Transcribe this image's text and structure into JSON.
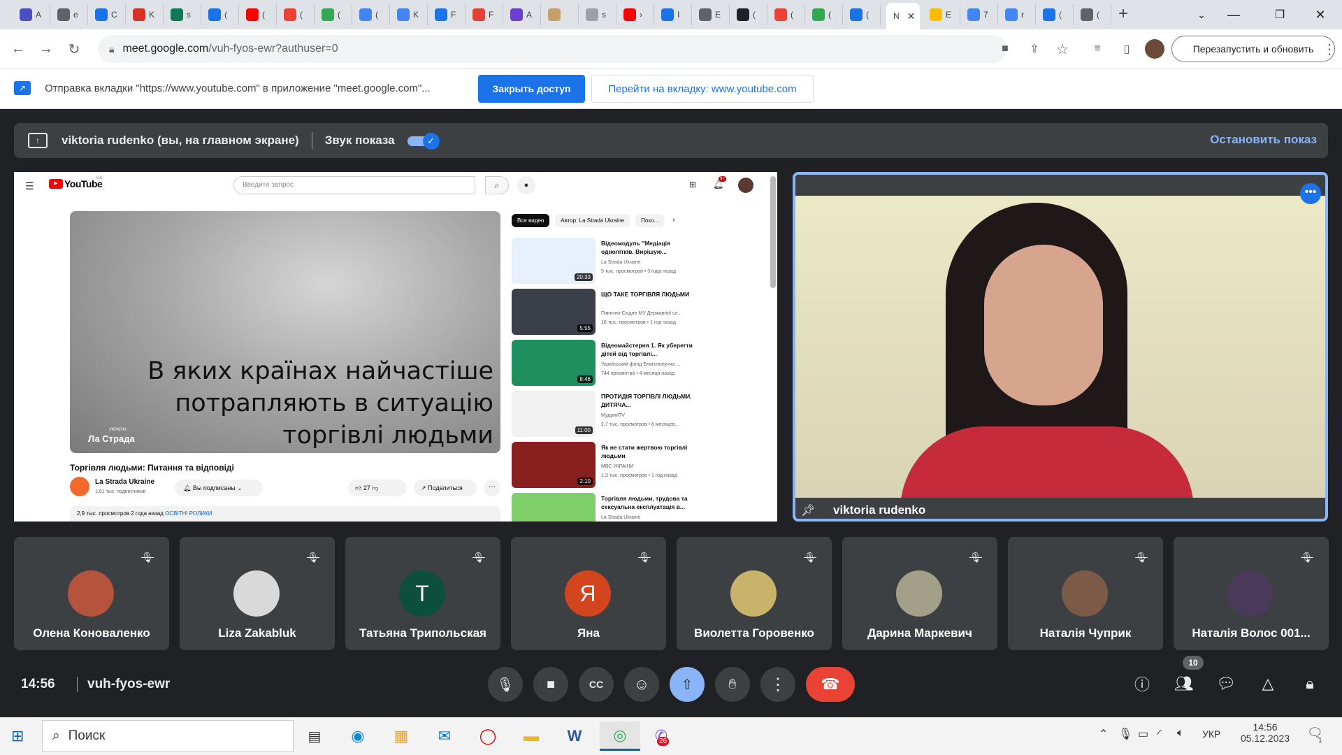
{
  "browser": {
    "tabs": [
      {
        "label": "A",
        "color": "#4a4fc2"
      },
      {
        "label": "e",
        "color": "#5f6368"
      },
      {
        "label": "C",
        "color": "#1a73e8"
      },
      {
        "label": "K",
        "color": "#d93025"
      },
      {
        "label": "s",
        "color": "#0d7a55"
      },
      {
        "label": "(",
        "color": "#1a73e8"
      },
      {
        "label": "(",
        "color": "#ff0000"
      },
      {
        "label": "(",
        "color": "#ea4335"
      },
      {
        "label": "(",
        "color": "#34a853"
      },
      {
        "label": "(",
        "color": "#4285f4"
      },
      {
        "label": "K",
        "color": "#4285f4"
      },
      {
        "label": "F",
        "color": "#1a73e8"
      },
      {
        "label": "F",
        "color": "#e34133"
      },
      {
        "label": "A",
        "color": "#6b3fd1"
      },
      {
        "label": "",
        "color": "#c6a06a"
      },
      {
        "label": "s",
        "color": "#9aa0a6"
      },
      {
        "label": "›",
        "color": "#ff0000"
      },
      {
        "label": "I",
        "color": "#1a73e8"
      },
      {
        "label": "E",
        "color": "#5f6368"
      },
      {
        "label": "(",
        "color": "#202124"
      },
      {
        "label": "(",
        "color": "#ea4335"
      },
      {
        "label": "(",
        "color": "#34a853"
      },
      {
        "label": "(",
        "color": "#1a73e8"
      }
    ],
    "active_tab_label": "N",
    "tabs_after": [
      {
        "label": "E",
        "color": "#fbbc04"
      },
      {
        "label": "7",
        "color": "#4285f4"
      },
      {
        "label": "r",
        "color": "#4285f4"
      },
      {
        "label": "(",
        "color": "#1a73e8"
      },
      {
        "label": "(",
        "color": "#5f6368"
      }
    ],
    "new_tab": "+",
    "url_host": "meet.google.com",
    "url_path": "/vuh-fyos-ewr?authuser=0",
    "relaunch_label": "Перезапустить и обновить"
  },
  "sharebar": {
    "message": "Отправка вкладки \"https://www.youtube.com\" в приложение \"meet.google.com\"...",
    "close_access": "Закрыть доступ",
    "goto_tab": "Перейти на вкладку: www.youtube.com"
  },
  "presenting": {
    "who": "viktoria rudenko (вы, на главном экране)",
    "sound_label": "Звук показа",
    "stop_label": "Остановить показ"
  },
  "youtube": {
    "logo": "YouTube",
    "logo_sup": "UA",
    "search_placeholder": "Введите запрос",
    "notif_badge": "9+",
    "video_overlay_text": [
      "В яких країнах найчастіше",
      "потрапляють в ситуацію",
      "торгівлі людьми"
    ],
    "watermark_small": "УКРАЇНА",
    "watermark": "Ла Страда",
    "title": "Торгівля людьми: Питання та відповіді",
    "channel": "La Strada Ukraine",
    "subs": "1,01 тыс. подписчиков",
    "subscribed": "Вы подписаны",
    "likes": "27",
    "share": "Поделиться",
    "desc_line": "2,9 тыс. просмотров  2 года назад",
    "desc_tag": "ОСВІТНІ РОЛИКИ",
    "chips": [
      "Все видео",
      "Автор: La Strada Ukraine",
      "Похо..."
    ],
    "related": [
      {
        "title": "Відеомодуль \"Медіація однолітків. Вирішую...",
        "channel": "La Strada Ukraine",
        "meta": "5 тыс. просмотров • 3 года назад",
        "duration": "20:33",
        "color": "#e8f0fe"
      },
      {
        "title": "ЩО ТАКЕ ТОРГІВЛЯ ЛЮДЬМИ",
        "channel": "Північно-Східне МУ Державної сл...",
        "meta": "16 тыс. просмотров • 1 год назад",
        "duration": "5:55",
        "color": "#3a3f4a"
      },
      {
        "title": "Відеомайстерня 1. Як уберегти дітей від торгівлі...",
        "channel": "Український фонд Благополучча ...",
        "meta": "744 просмотра • 4 месяца назад",
        "duration": "8:46",
        "color": "#1f8f5f"
      },
      {
        "title": "ПРОТИДІЯ ТОРГІВЛІ ЛЮДЬМИ. ДИТЯЧА...",
        "channel": "МудрийTV",
        "meta": "2,7 тыс. просмотров • 6 месяцев...",
        "duration": "11:00",
        "color": "#f1f1f1"
      },
      {
        "title": "Як не стати жертвою торгівлі людьми",
        "channel": "МВС УКРАЇНИ",
        "meta": "1,3 тыс. просмотров • 1 год назад",
        "duration": "2:10",
        "color": "#8a1f1f"
      },
      {
        "title": "Торгівля людьми, трудова та сексуальна експлуатація в...",
        "channel": "La Strada Ukraine",
        "meta": "",
        "duration": "",
        "color": "#7ecf6a"
      }
    ]
  },
  "main_video": {
    "name": "viktoria rudenko"
  },
  "participants": [
    {
      "name": "Олена Коноваленко",
      "initial": "",
      "color": "#b5533c"
    },
    {
      "name": "Liza Zakabluk",
      "initial": "",
      "color": "#d9d9d9"
    },
    {
      "name": "Татьяна Трипольская",
      "initial": "T",
      "color": "#0b4f3c"
    },
    {
      "name": "Яна",
      "initial": "Я",
      "color": "#d2451e"
    },
    {
      "name": "Виолетта Горовенко",
      "initial": "",
      "color": "#c9b26a"
    },
    {
      "name": "Дарина Маркевич",
      "initial": "",
      "color": "#a3a08a"
    },
    {
      "name": "Наталія Чуприк",
      "initial": "",
      "color": "#7b5a48"
    },
    {
      "name": "Наталія Волос 001...",
      "initial": "",
      "color": "#4a3a5a"
    }
  ],
  "footer": {
    "time": "14:56",
    "code": "vuh-fyos-ewr",
    "people_count": "10"
  },
  "taskbar": {
    "search": "Поиск",
    "lang": "УКР",
    "time": "14:56",
    "date": "05.12.2023",
    "viber_badge": "26",
    "notif_badge": "1"
  }
}
